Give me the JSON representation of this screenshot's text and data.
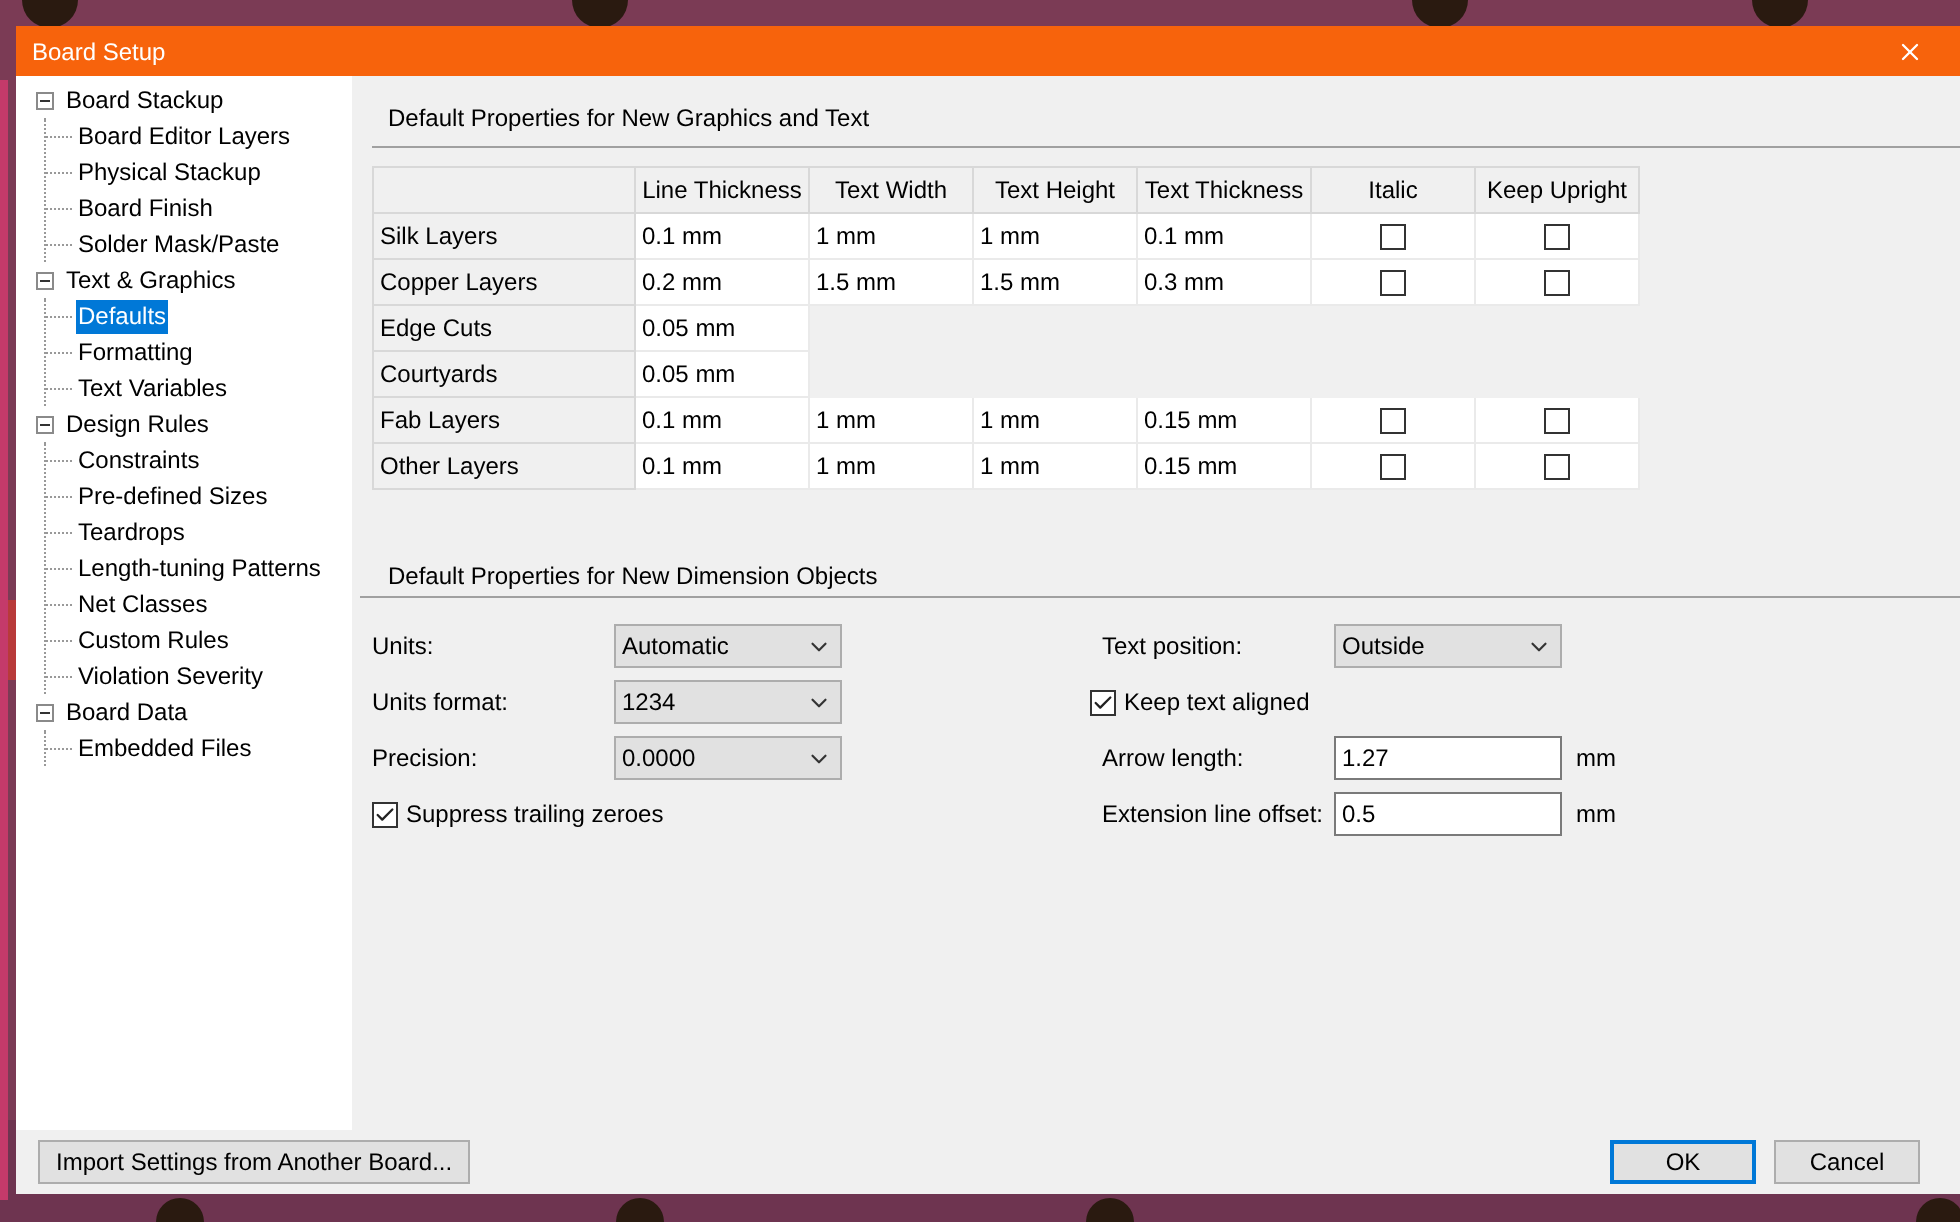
{
  "window": {
    "title": "Board Setup"
  },
  "sidebar": {
    "items": [
      {
        "label": "Board Stackup",
        "expanded": true,
        "selected": false,
        "children": [
          {
            "label": "Board Editor Layers",
            "selected": false
          },
          {
            "label": "Physical Stackup",
            "selected": false
          },
          {
            "label": "Board Finish",
            "selected": false
          },
          {
            "label": "Solder Mask/Paste",
            "selected": false
          }
        ]
      },
      {
        "label": "Text & Graphics",
        "expanded": true,
        "selected": false,
        "children": [
          {
            "label": "Defaults",
            "selected": true
          },
          {
            "label": "Formatting",
            "selected": false
          },
          {
            "label": "Text Variables",
            "selected": false
          }
        ]
      },
      {
        "label": "Design Rules",
        "expanded": true,
        "selected": false,
        "children": [
          {
            "label": "Constraints",
            "selected": false
          },
          {
            "label": "Pre-defined Sizes",
            "selected": false
          },
          {
            "label": "Teardrops",
            "selected": false
          },
          {
            "label": "Length-tuning Patterns",
            "selected": false
          },
          {
            "label": "Net Classes",
            "selected": false
          },
          {
            "label": "Custom Rules",
            "selected": false
          },
          {
            "label": "Violation Severity",
            "selected": false
          }
        ]
      },
      {
        "label": "Board Data",
        "expanded": true,
        "selected": false,
        "children": [
          {
            "label": "Embedded Files",
            "selected": false
          }
        ]
      }
    ]
  },
  "graphics": {
    "title": "Default Properties for New Graphics and Text",
    "table": {
      "columns": [
        "Line Thickness",
        "Text Width",
        "Text Height",
        "Text Thickness",
        "Italic",
        "Keep Upright"
      ],
      "rows": [
        {
          "label": "Silk Layers",
          "values": [
            "0.1 mm",
            "1 mm",
            "1 mm",
            "0.1 mm"
          ],
          "italic": false,
          "keep_upright": false
        },
        {
          "label": "Copper Layers",
          "values": [
            "0.2 mm",
            "1.5 mm",
            "1.5 mm",
            "0.3 mm"
          ],
          "italic": false,
          "keep_upright": false
        },
        {
          "label": "Edge Cuts",
          "values": [
            "0.05 mm"
          ]
        },
        {
          "label": "Courtyards",
          "values": [
            "0.05 mm"
          ]
        },
        {
          "label": "Fab Layers",
          "values": [
            "0.1 mm",
            "1 mm",
            "1 mm",
            "0.15 mm"
          ],
          "italic": false,
          "keep_upright": false
        },
        {
          "label": "Other Layers",
          "values": [
            "0.1 mm",
            "1 mm",
            "1 mm",
            "0.15 mm"
          ],
          "italic": false,
          "keep_upright": false
        }
      ]
    }
  },
  "dimension": {
    "title": "Default Properties for New Dimension Objects",
    "left": [
      {
        "kind": "select",
        "label": "Units:",
        "value": "Automatic"
      },
      {
        "kind": "select",
        "label": "Units format:",
        "value": "1234"
      },
      {
        "kind": "select",
        "label": "Precision:",
        "value": "0.0000"
      },
      {
        "kind": "checkbox",
        "label": "Suppress trailing zeroes",
        "checked": true
      }
    ],
    "right": [
      {
        "kind": "select",
        "label": "Text position:",
        "value": "Outside"
      },
      {
        "kind": "checkbox",
        "label": "Keep text aligned",
        "checked": true
      },
      {
        "kind": "input",
        "label": "Arrow length:",
        "value": "1.27",
        "unit": "mm"
      },
      {
        "kind": "input",
        "label": "Extension line offset:",
        "value": "0.5",
        "unit": "mm"
      }
    ]
  },
  "buttons": {
    "import": "Import Settings from Another Board...",
    "ok": "OK",
    "cancel": "Cancel"
  }
}
